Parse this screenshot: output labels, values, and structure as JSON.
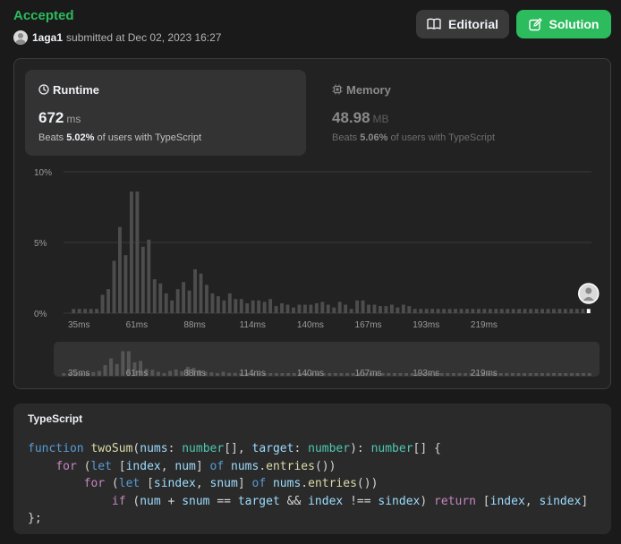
{
  "submission": {
    "status": "Accepted",
    "user": "1aga1",
    "submitted_text": "submitted at Dec 02, 2023 16:27"
  },
  "buttons": {
    "editorial": "Editorial",
    "solution": "Solution"
  },
  "runtime": {
    "label": "Runtime",
    "value": "672",
    "unit": "ms",
    "beats_prefix": "Beats",
    "beats_pct": "5.02%",
    "beats_suffix": "of users with TypeScript",
    "icon": "clock-icon"
  },
  "memory": {
    "label": "Memory",
    "value": "48.98",
    "unit": "MB",
    "beats_prefix": "Beats",
    "beats_pct": "5.06%",
    "beats_suffix": "of users with TypeScript",
    "icon": "chip-icon"
  },
  "colors": {
    "accepted": "#2cbb5d",
    "bar": "#4d4d4d",
    "bar_highlight": "#ffffff"
  },
  "chart_data": {
    "type": "bar",
    "xlabel": "",
    "ylabel": "",
    "yticks": [
      "10%",
      "5%",
      "0%"
    ],
    "ylim": [
      0,
      10
    ],
    "xticks": [
      "35ms",
      "61ms",
      "88ms",
      "114ms",
      "140ms",
      "167ms",
      "193ms",
      "219ms"
    ],
    "series": [
      {
        "values": [
          0.3,
          0.3,
          0.3,
          0.3,
          0.3,
          1.3,
          1.7,
          3.7,
          6.1,
          4.1,
          8.6,
          8.6,
          4.7,
          5.2,
          2.4,
          2.1,
          1.4,
          0.9,
          1.7,
          2.2,
          1.6,
          3.1,
          2.8,
          2.0,
          1.4,
          1.2,
          0.9,
          1.4,
          1.0,
          1.0,
          0.7,
          0.9,
          0.9,
          0.8,
          1.0,
          0.5,
          0.7,
          0.6,
          0.4,
          0.6,
          0.6,
          0.6,
          0.7,
          0.8,
          0.6,
          0.4,
          0.8,
          0.6,
          0.3,
          0.9,
          0.9,
          0.6,
          0.6,
          0.5,
          0.5,
          0.6,
          0.4,
          0.6,
          0.5,
          0.3,
          0.3,
          0.3,
          0.3,
          0.3,
          0.3,
          0.3,
          0.3,
          0.3,
          0.3,
          0.3,
          0.3,
          0.3,
          0.3,
          0.3,
          0.3,
          0.3,
          0.3,
          0.3,
          0.3,
          0.3,
          0.3,
          0.3,
          0.3,
          0.3,
          0.3,
          0.3,
          0.3,
          0.3,
          0.3,
          0.3
        ],
        "highlight_index": 89
      }
    ],
    "grid": true,
    "marker": "user-avatar at current runtime"
  },
  "code": {
    "language": "TypeScript"
  }
}
